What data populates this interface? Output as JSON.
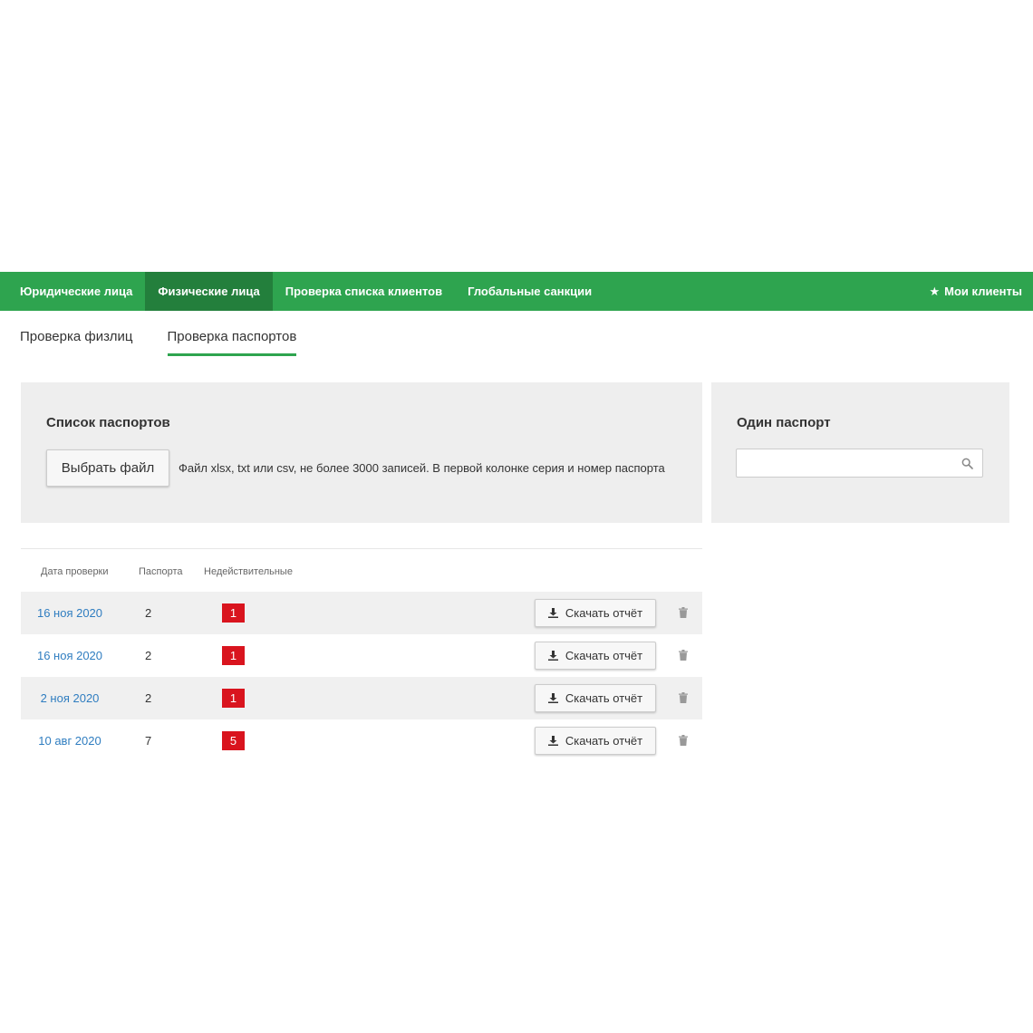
{
  "topnav": {
    "items": [
      {
        "label": "Юридические лица"
      },
      {
        "label": "Физические лица"
      },
      {
        "label": "Проверка списка клиентов"
      },
      {
        "label": "Глобальные санкции"
      }
    ],
    "active_index": 1,
    "my_clients": {
      "icon": "star-icon",
      "label": "Мои клиенты"
    }
  },
  "subtabs": {
    "items": [
      {
        "label": "Проверка физлиц"
      },
      {
        "label": "Проверка паспортов"
      }
    ],
    "active_index": 1
  },
  "passport_list": {
    "title": "Список паспортов",
    "file_button": "Выбрать файл",
    "hint": "Файл xlsx, txt или csv, не более 3000 записей. В первой колонке серия и номер паспорта"
  },
  "single_passport": {
    "title": "Один паспорт",
    "search_value": "",
    "search_icon": "search-icon"
  },
  "table": {
    "headers": {
      "date": "Дата проверки",
      "passports": "Паспорта",
      "invalid": "Недействительные"
    },
    "download_label": "Скачать отчёт",
    "rows": [
      {
        "date": "16 ноя 2020",
        "passports": "2",
        "invalid": "1"
      },
      {
        "date": "16 ноя 2020",
        "passports": "2",
        "invalid": "1"
      },
      {
        "date": "2 ноя 2020",
        "passports": "2",
        "invalid": "1"
      },
      {
        "date": "10 авг 2020",
        "passports": "7",
        "invalid": "5"
      }
    ]
  },
  "colors": {
    "accent_green": "#2ea44f",
    "active_tab_green": "#237f3c",
    "badge_red": "#d9141e",
    "link_blue": "#2f7dc0"
  }
}
